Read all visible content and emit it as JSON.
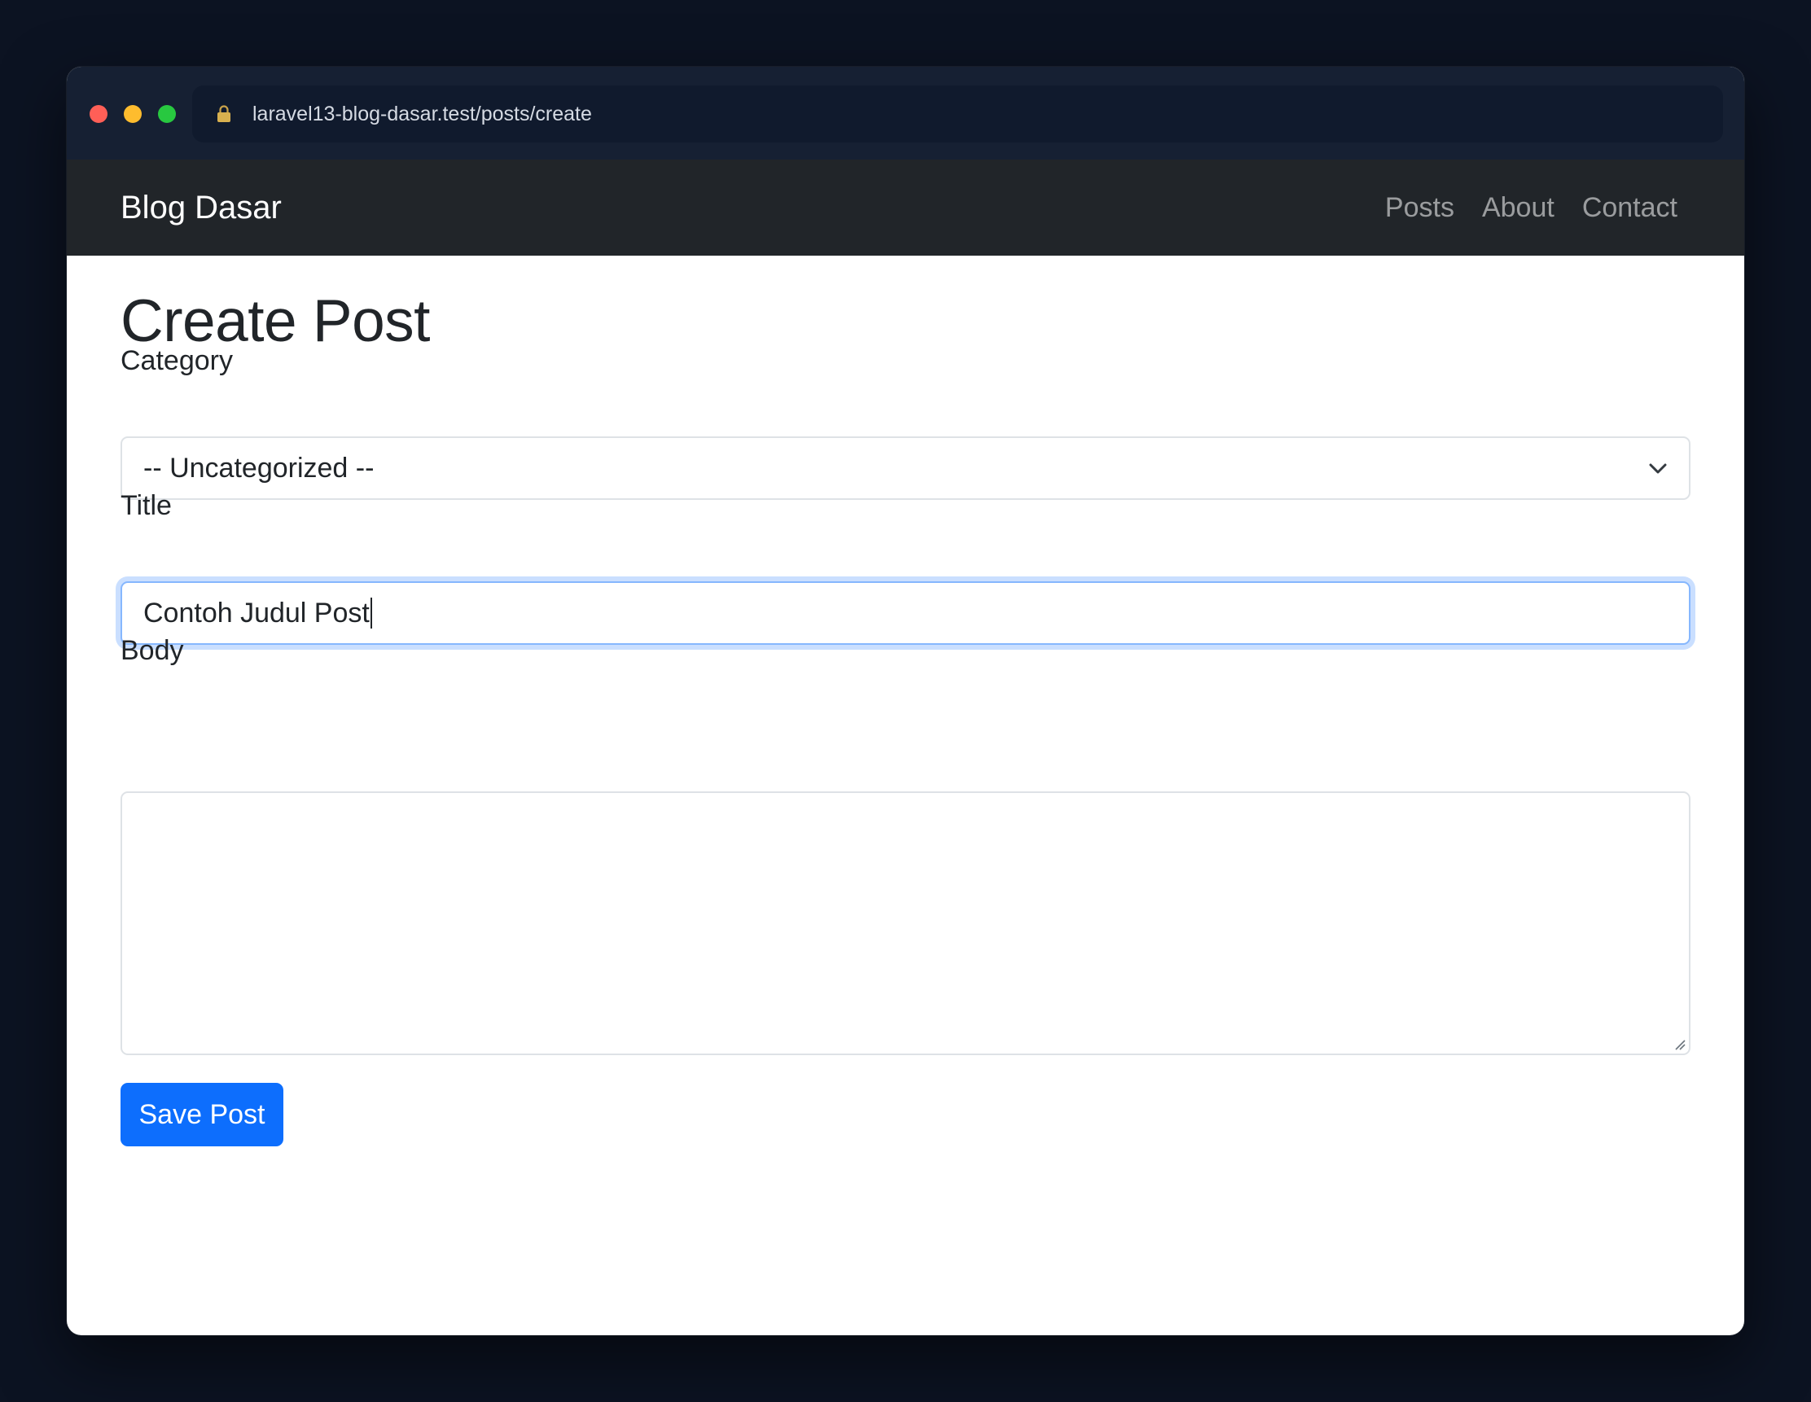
{
  "browser": {
    "url": "laravel13-blog-dasar.test/posts/create",
    "lock_icon": "lock-icon"
  },
  "navbar": {
    "brand": "Blog Dasar",
    "links": [
      {
        "label": "Posts"
      },
      {
        "label": "About"
      },
      {
        "label": "Contact"
      }
    ]
  },
  "page": {
    "title": "Create Post"
  },
  "form": {
    "category": {
      "label": "Category",
      "selected": "-- Uncategorized --"
    },
    "title": {
      "label": "Title",
      "value": "Contoh Judul Post"
    },
    "body": {
      "label": "Body",
      "value": ""
    },
    "submit_label": "Save Post"
  },
  "colors": {
    "background": "#0c1322",
    "navbar": "#212529",
    "primary": "#0d6efd",
    "focus_border": "#86b7fe"
  }
}
